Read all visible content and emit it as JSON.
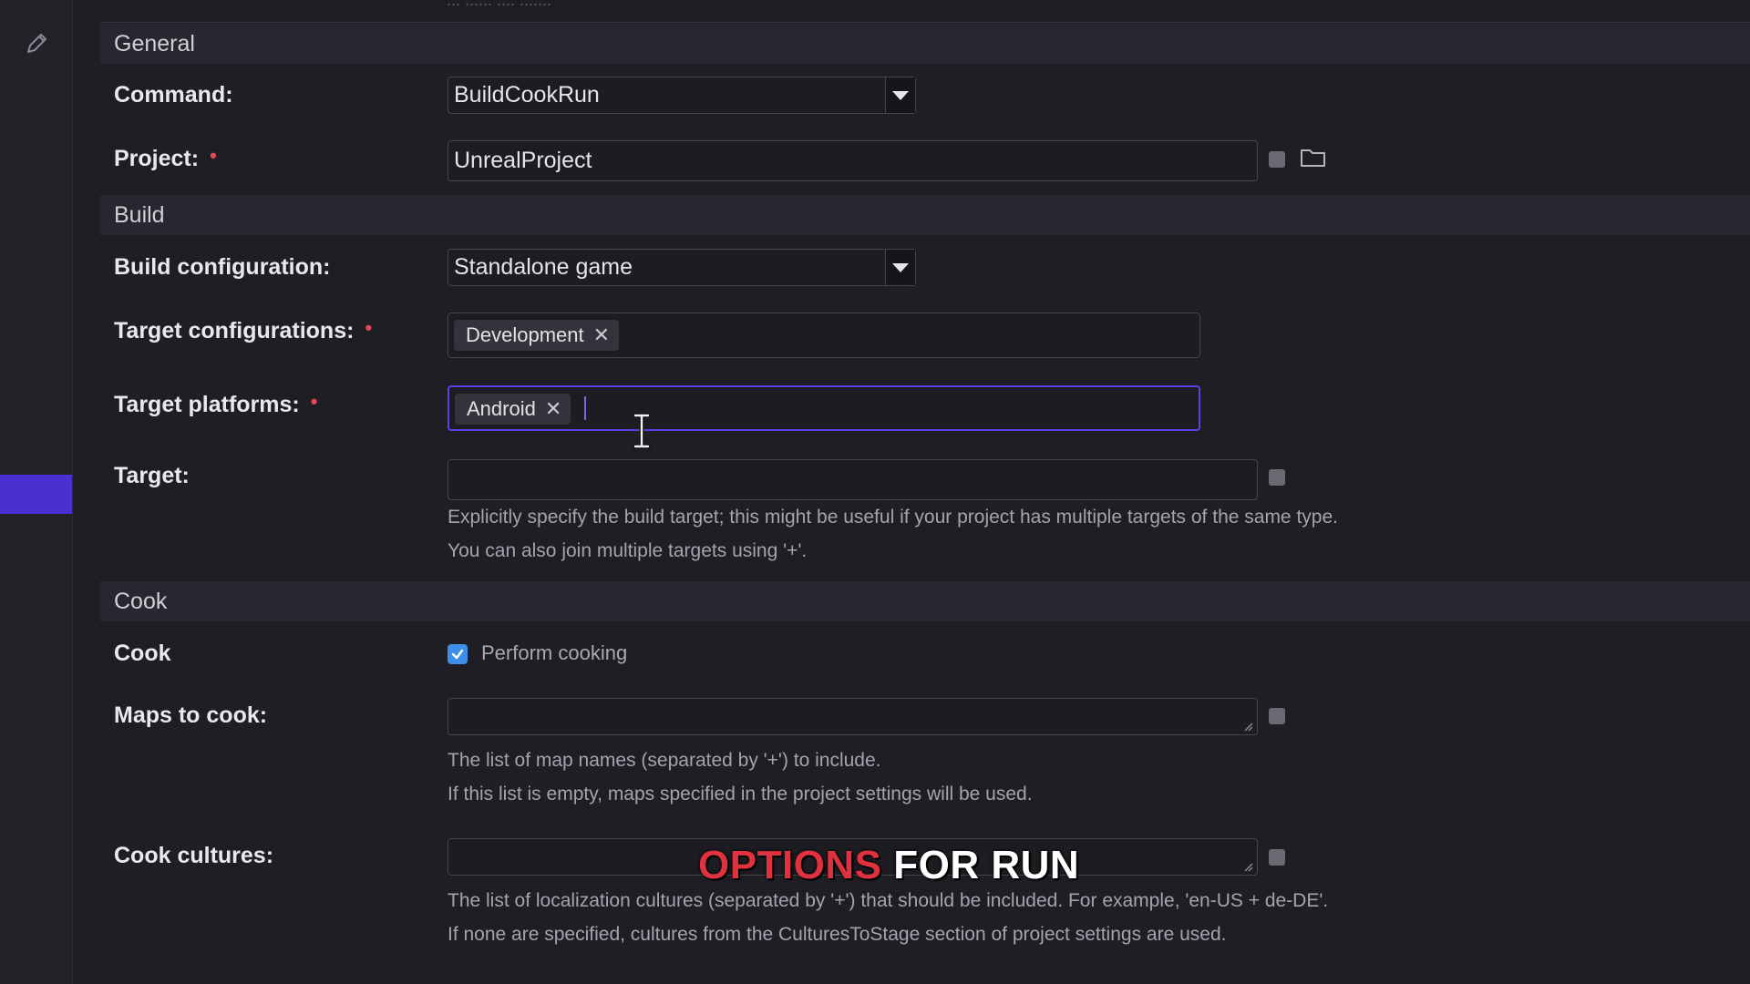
{
  "sections": {
    "general": "General",
    "build": "Build",
    "cook": "Cook"
  },
  "top_fragment": "... ...... .... .......",
  "fields": {
    "command": {
      "label": "Command:",
      "value": "BuildCookRun"
    },
    "project": {
      "label": "Project:",
      "value": "UnrealProject"
    },
    "build_configuration": {
      "label": "Build configuration:",
      "value": "Standalone game"
    },
    "target_configurations": {
      "label": "Target configurations:",
      "chip": "Development"
    },
    "target_platforms": {
      "label": "Target platforms:",
      "chip": "Android"
    },
    "target": {
      "label": "Target:",
      "value": "",
      "help_1": "Explicitly specify the build target; this might be useful if your project has multiple targets of the same type.",
      "help_2": "You can also join multiple targets using '+'."
    },
    "cook": {
      "label": "Cook",
      "checkbox_label": "Perform cooking",
      "checked": true
    },
    "maps_to_cook": {
      "label": "Maps to cook:",
      "value": "",
      "help_1": "The list of map names (separated by '+') to include.",
      "help_2": "If this list is empty, maps specified in the project settings will be used."
    },
    "cook_cultures": {
      "label": "Cook cultures:",
      "value": "",
      "help_1": "The list of localization cultures (separated by '+') that should be included. For example, 'en-US + de-DE'.",
      "help_2": "If none are specified, cultures from the CulturesToStage section of project settings are used."
    }
  },
  "required_marker": "•",
  "caption": {
    "highlight": "OPTIONS",
    "rest": " FOR RUN"
  },
  "colors": {
    "accent": "#5a42e0",
    "required": "#e04a57",
    "checkbox": "#3d8ee6",
    "caption_highlight": "#e0313f"
  },
  "icons": [
    "pencil-icon",
    "folder-icon",
    "chevron-down-icon",
    "close-icon",
    "text-cursor-icon",
    "resize-handle-icon"
  ]
}
